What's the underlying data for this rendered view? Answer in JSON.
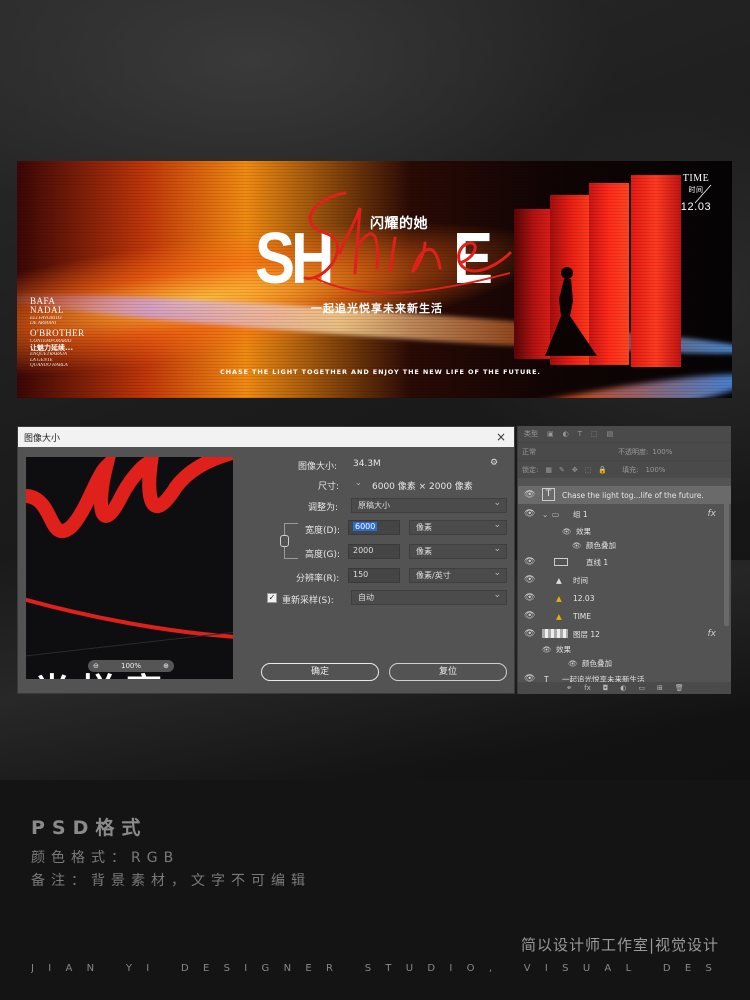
{
  "banner": {
    "title_left": "SH",
    "title_right": "E",
    "script_word": "hine",
    "cn_title": "闪耀的她",
    "slogan": "一起追光悦享未来新生活",
    "english_line": "CHASE THE LIGHT TOGETHER AND ENJOY THE NEW LIFE OF THE FUTURE.",
    "time_label": "TIME",
    "time_cn": "时间",
    "date": "12.03",
    "left_col": {
      "line1": "BAFA",
      "line2": "NADAL",
      "line3": "ELI FAVORITO",
      "line4": "DE ARMANI",
      "line5": "O'BROTHER",
      "line6": "CONTEMPORARIO",
      "line7": "让魅力延续...",
      "line8": "ENQUETRABAJA",
      "line9": "LA GENTE",
      "line10": "QUANDO HABLA"
    }
  },
  "dialog": {
    "title": "图像大小",
    "close_label": "×",
    "image_size_label": "图像大小:",
    "image_size_value": "34.3M",
    "dimensions_label": "尺寸:",
    "dimensions_value": "6000 像素 × 2000 像素",
    "fit_label": "调整为:",
    "fit_value": "原稿大小",
    "width_label": "宽度(D):",
    "width_value": "6000",
    "width_unit": "像素",
    "height_label": "高度(G):",
    "height_value": "2000",
    "height_unit": "像素",
    "resolution_label": "分辨率(R):",
    "resolution_value": "150",
    "resolution_unit": "像素/英寸",
    "resample_label": "重新采样(S):",
    "resample_value": "自动",
    "zoom_value": "100%",
    "ok_label": "确定",
    "reset_label": "复位",
    "preview_text": "光悦享"
  },
  "layers": {
    "header_kind": "类型",
    "blend_mode": "正常",
    "opacity_label": "不透明度:",
    "opacity_value": "100%",
    "lock_label": "锁定:",
    "fill_label": "填充:",
    "fill_value": "100%",
    "items": [
      {
        "name": "Chase the light tog...life of the future.",
        "kind": "T"
      },
      {
        "name": "组 1",
        "kind": "group"
      },
      {
        "name": "效果",
        "kind": "effect"
      },
      {
        "name": "颜色叠加",
        "kind": "effect-item"
      },
      {
        "name": "直线 1",
        "kind": "shape"
      },
      {
        "name": "时间",
        "kind": "smart"
      },
      {
        "name": "12.03",
        "kind": "smart"
      },
      {
        "name": "TIME",
        "kind": "smart"
      },
      {
        "name": "图层 12",
        "kind": "pixel"
      },
      {
        "name": "效果",
        "kind": "effect"
      },
      {
        "name": "颜色叠加",
        "kind": "effect-item"
      },
      {
        "name": "一起追光悦享未来新生活",
        "kind": "T"
      }
    ],
    "fx_label": "fx"
  },
  "footer": {
    "format_title": "PSD格式",
    "color_mode": "颜色格式：RGB",
    "note": "备注：背景素材，文字不可编辑",
    "studio_cn": "简以设计师工作室|视觉设计",
    "studio_en": "JIAN YI DESIGNER STUDIO, VISUAL DESIGN"
  },
  "colors": {
    "accent_red": "#e0201a",
    "selection_blue": "#2c6bd6",
    "panel_gray": "#535353"
  }
}
